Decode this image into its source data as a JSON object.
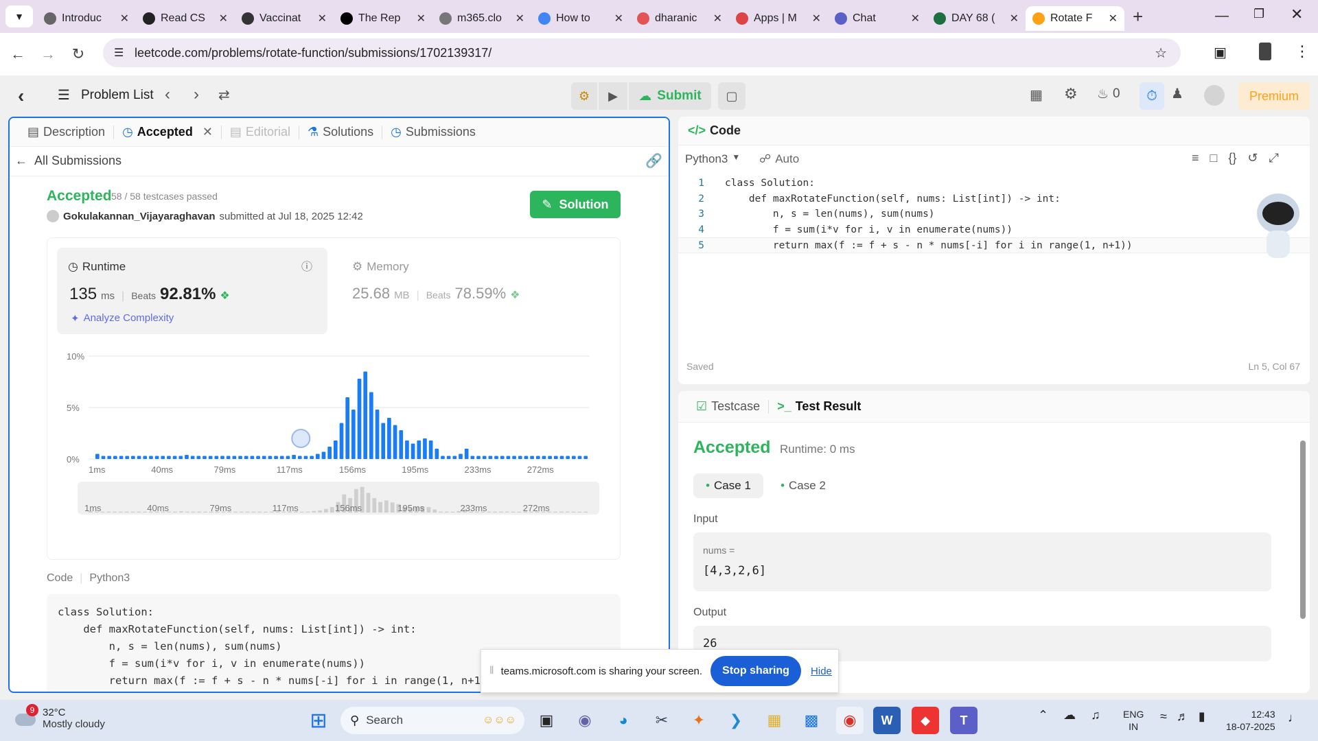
{
  "browser": {
    "tabs": [
      {
        "title": "Introduc",
        "color": "#666"
      },
      {
        "title": "Read CS",
        "color": "#222"
      },
      {
        "title": "Vaccinat",
        "color": "#333"
      },
      {
        "title": "The Rep",
        "color": "#000"
      },
      {
        "title": "m365.clo",
        "color": "#777"
      },
      {
        "title": "How to",
        "color": "#4285f4"
      },
      {
        "title": "dharanic",
        "color": "#e25555"
      },
      {
        "title": "Apps | M",
        "color": "#d44"
      },
      {
        "title": "Chat",
        "color": "#5b5fc7"
      },
      {
        "title": "DAY 68 (",
        "color": "#1d6f42"
      },
      {
        "title": "Rotate F",
        "color": "#ffa116"
      }
    ],
    "url": "leetcode.com/problems/rotate-function/submissions/1702139317/"
  },
  "header": {
    "problem_list": "Problem List",
    "submit": "Submit",
    "streak": "0",
    "premium": "Premium"
  },
  "left_tabs": {
    "description": "Description",
    "accepted": "Accepted",
    "editorial": "Editorial",
    "solutions": "Solutions",
    "submissions": "Submissions"
  },
  "submission": {
    "all_submissions": "All Submissions",
    "status": "Accepted",
    "testcases": "58 / 58 testcases passed",
    "user": "Gokulakannan_Vijayaraghavan",
    "submitted": "submitted at Jul 18, 2025 12:42",
    "solution_btn": "Solution",
    "runtime_label": "Runtime",
    "runtime_value": "135",
    "runtime_unit": "ms",
    "beats_label": "Beats",
    "runtime_beats": "92.81%",
    "analyze": "Analyze Complexity",
    "memory_label": "Memory",
    "memory_value": "25.68",
    "memory_unit": "MB",
    "memory_beats": "78.59%",
    "code_label": "Code",
    "lang": "Python3"
  },
  "chart_data": {
    "type": "bar",
    "ylabels": [
      "10%",
      "5%",
      "0%"
    ],
    "ylim": [
      0,
      10
    ],
    "xticks": [
      "1ms",
      "40ms",
      "79ms",
      "117ms",
      "156ms",
      "195ms",
      "233ms",
      "272ms"
    ],
    "values": [
      0.5,
      0.3,
      0.3,
      0.3,
      0.3,
      0.3,
      0.3,
      0.3,
      0.3,
      0.3,
      0.3,
      0.3,
      0.3,
      0.3,
      0.3,
      0.4,
      0.3,
      0.3,
      0.3,
      0.3,
      0.3,
      0.3,
      0.3,
      0.3,
      0.3,
      0.3,
      0.3,
      0.3,
      0.3,
      0.3,
      0.3,
      0.3,
      0.3,
      0.4,
      0.3,
      0.3,
      0.3,
      0.5,
      0.7,
      1.2,
      1.8,
      3.5,
      6.0,
      4.8,
      7.8,
      8.5,
      6.5,
      4.8,
      3.5,
      4.0,
      3.3,
      2.8,
      1.8,
      1.5,
      1.8,
      2.0,
      1.8,
      1.0,
      0.3,
      0.3,
      0.3,
      0.5,
      1.0,
      0.3,
      0.3,
      0.3,
      0.3,
      0.3,
      0.3,
      0.3,
      0.3,
      0.3,
      0.3,
      0.3,
      0.3,
      0.3,
      0.3,
      0.3,
      0.3,
      0.3,
      0.3,
      0.3,
      0.3
    ],
    "highlight_index": 34
  },
  "code_lines": [
    "class Solution:",
    "    def maxRotateFunction(self, nums: List[int]) -> int:",
    "        n, s = len(nums), sum(nums)",
    "        f = sum(i*v for i, v in enumerate(nums))",
    "        return max(f := f + s - n * nums[-i] for i in range(1, n+1))"
  ],
  "editor": {
    "title": "Code",
    "lang": "Python3",
    "auto": "Auto",
    "saved": "Saved",
    "cursor": "Ln 5, Col 67",
    "line_numbers": [
      "1",
      "2",
      "3",
      "4",
      "5"
    ]
  },
  "test": {
    "testcase_tab": "Testcase",
    "result_tab": "Test Result",
    "status": "Accepted",
    "runtime": "Runtime: 0 ms",
    "case1": "Case 1",
    "case2": "Case 2",
    "input_label": "Input",
    "var": "nums =",
    "value": "[4,3,2,6]",
    "output_label": "Output",
    "output": "26"
  },
  "share": {
    "text": "teams.microsoft.com is sharing your screen.",
    "stop": "Stop sharing",
    "hide": "Hide"
  },
  "taskbar": {
    "temp": "32°C",
    "weather": "Mostly cloudy",
    "badge": "9",
    "search": "Search",
    "lang1": "ENG",
    "lang2": "IN",
    "time": "12:43",
    "date": "18-07-2025"
  }
}
